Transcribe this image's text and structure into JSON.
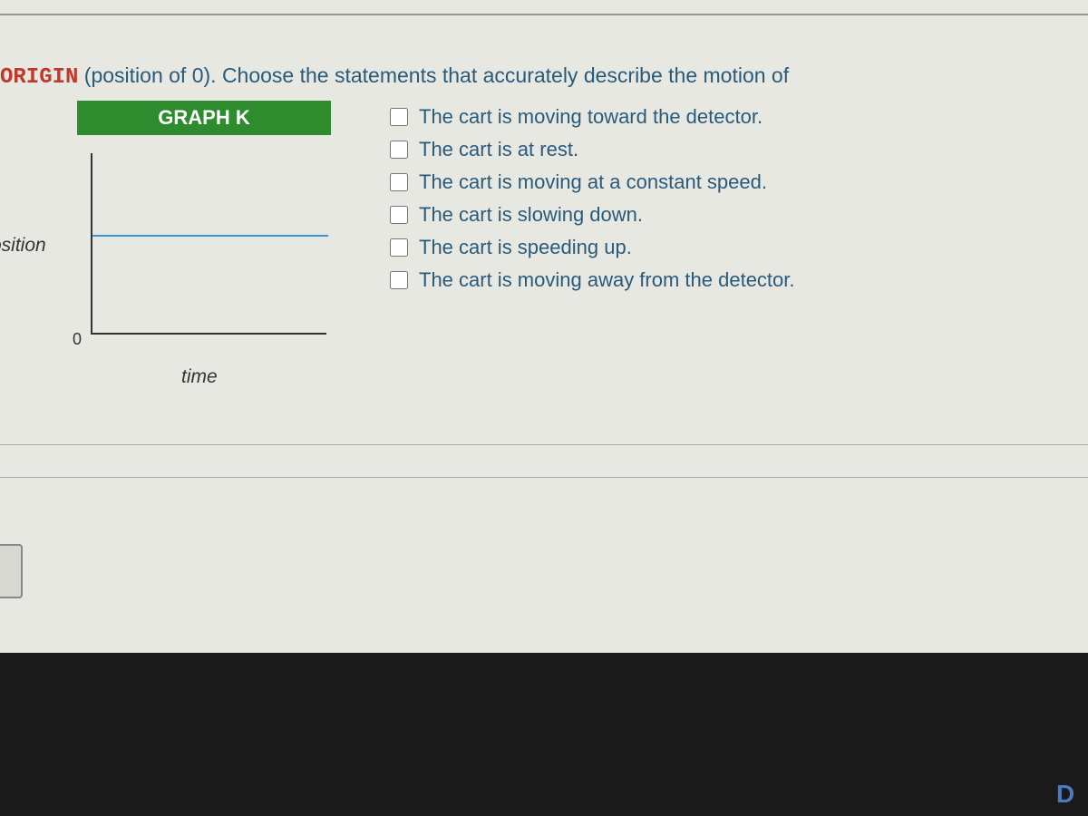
{
  "question": {
    "prefix_word": "ORIGIN",
    "text_suffix": " (position of 0). Choose the statements that accurately describe the motion of"
  },
  "graph": {
    "title": "GRAPH K",
    "y_label": "osition",
    "x_label": "time",
    "origin_label": "0"
  },
  "choices": [
    {
      "label": "The cart is moving toward the detector."
    },
    {
      "label": "The cart is at rest."
    },
    {
      "label": "The cart is moving at a constant speed."
    },
    {
      "label": "The cart is slowing down."
    },
    {
      "label": "The cart is speeding up."
    },
    {
      "label": "The cart is moving away from the detector."
    }
  ],
  "chart_data": {
    "type": "line",
    "title": "GRAPH K",
    "xlabel": "time",
    "ylabel": "position",
    "description": "horizontal flat line at constant positive position over time",
    "x": [
      0,
      10
    ],
    "y": [
      5,
      5
    ],
    "ylim": [
      0,
      10
    ]
  }
}
